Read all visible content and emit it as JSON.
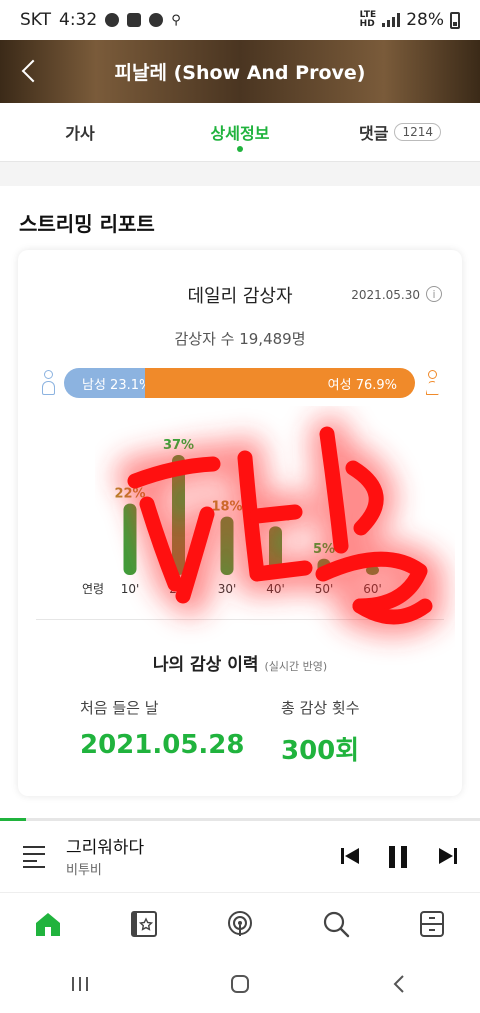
{
  "status_bar": {
    "carrier": "SKT",
    "time": "4:32",
    "network_label": "LTE",
    "volte_label": "HD",
    "battery": "28%"
  },
  "header": {
    "title": "피날레 (Show And Prove)"
  },
  "tabs": [
    {
      "label": "가사"
    },
    {
      "label": "상세정보"
    },
    {
      "label": "댓글",
      "count": "1214"
    }
  ],
  "report": {
    "section_title": "스트리밍 리포트",
    "daily_title": "데일리 감상자",
    "date": "2021.05.30",
    "listeners_text": "감상자 수 19,489명",
    "gender": {
      "male_label": "남성 23.1%",
      "female_label": "여성 76.9%",
      "male_share": 0.231,
      "male_color": "#8cb3e0",
      "female_color": "#f08a2a"
    }
  },
  "chart_data": {
    "type": "bar",
    "axis_label": "연령",
    "categories": [
      "10'",
      "20'",
      "30'",
      "40'",
      "50'",
      "60'"
    ],
    "values": [
      22,
      37,
      18,
      15,
      5,
      3
    ],
    "value_labels": [
      "22%",
      "37%",
      "18%",
      "15%",
      "5%",
      ""
    ],
    "bar_color": "#3f9e3a",
    "label_colors": [
      "#b08a2a",
      "#20b33d",
      "#b08a2a",
      "#b08a2a",
      "#20b33d",
      "#20b33d"
    ]
  },
  "history": {
    "title": "나의 감상 이력",
    "note": "(실시간 반영)",
    "first_listen_label": "처음 들은 날",
    "first_listen_value": "2021.05.28",
    "total_plays_label": "총 감상 횟수",
    "total_plays_value": "300회"
  },
  "player": {
    "song_title": "그리워하다",
    "artist": "비투비",
    "progress": 0.055
  },
  "bottom_nav": [
    "home-icon",
    "library-icon",
    "podcast-icon",
    "search-icon",
    "storage-icon"
  ],
  "accent_color": "#20b33d"
}
